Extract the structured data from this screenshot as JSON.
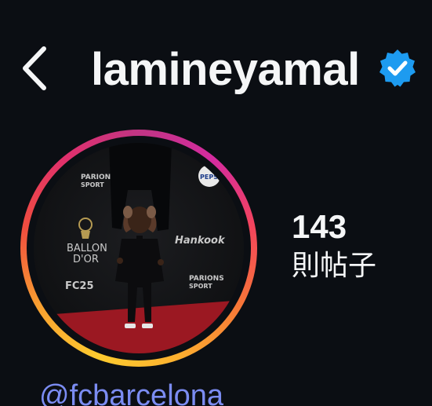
{
  "header": {
    "username": "lamineyamal",
    "back_icon": "chevron-left-icon",
    "verified_icon": "verified-badge-icon",
    "verified_color": "#1d9bf0"
  },
  "profile": {
    "avatar_story_ring": [
      "#fdcb2f",
      "#f77737",
      "#e1306c",
      "#c13584"
    ],
    "avatar_backdrop": {
      "ballon_dor_text": [
        "BALLON",
        "D'OR"
      ],
      "parions_text": [
        "PARIONS",
        "SPORT"
      ],
      "sponsor_pepsi": "PEPSI",
      "sponsor_hankook": "Hankook",
      "sponsor_fc": "FC25"
    }
  },
  "stats": {
    "posts_count": "143",
    "posts_label": "則帖子"
  },
  "bio": {
    "mention": "@fcbarcelona",
    "mention_color": "#7b8cf2"
  }
}
